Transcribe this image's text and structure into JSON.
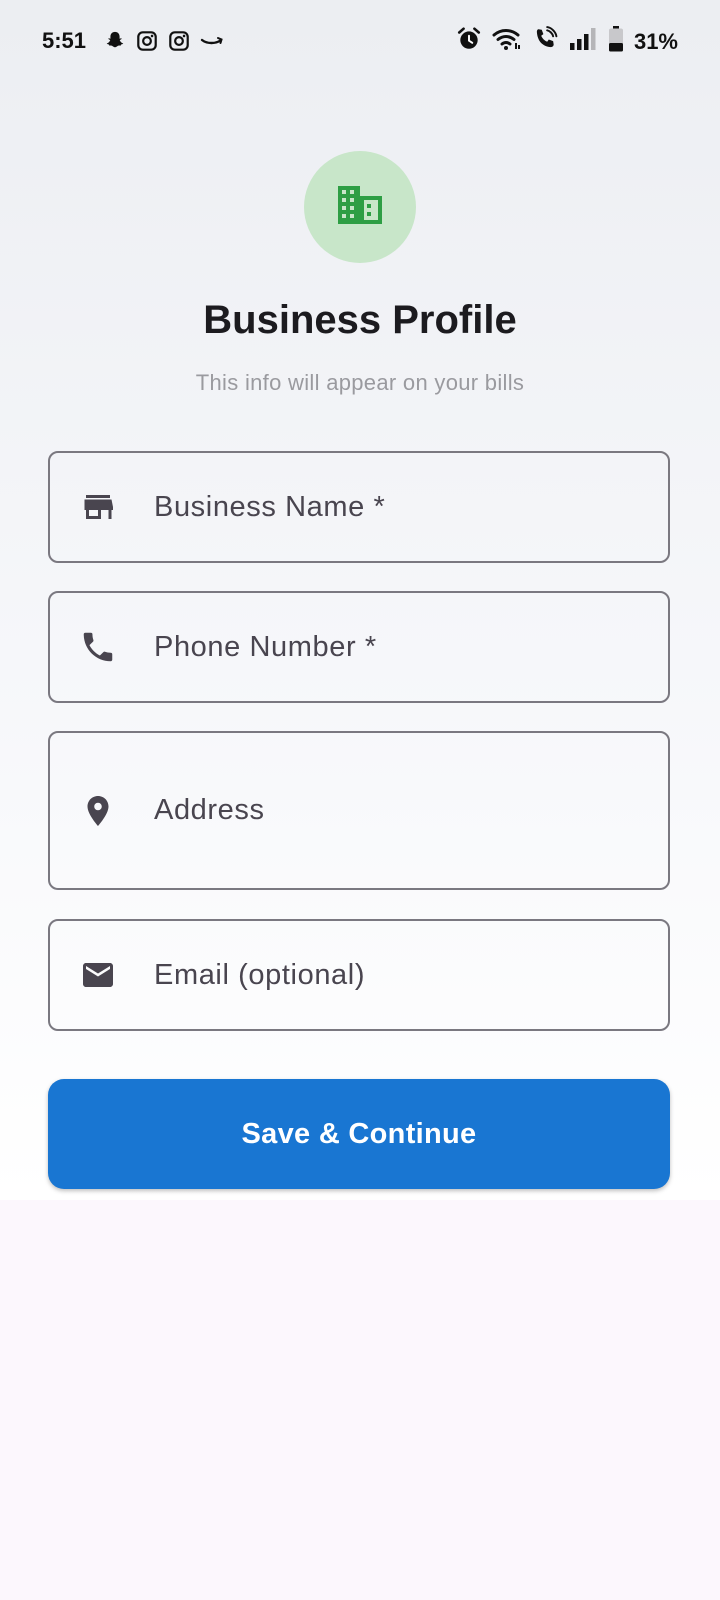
{
  "status_bar": {
    "time": "5:51",
    "battery": "31%",
    "left_icons": [
      "snapchat-icon",
      "instagram-icon",
      "instagram-icon",
      "amazon-icon"
    ],
    "right_icons": [
      "alarm-icon",
      "wifi-icon",
      "wifi-calling-icon",
      "signal-icon",
      "battery-icon"
    ]
  },
  "header": {
    "logo_icon": "building-icon",
    "logo_color": "#2e9e44",
    "logo_bg": "#c8e6c9",
    "title": "Business Profile",
    "subtitle": "This info will appear on your bills"
  },
  "form": {
    "fields": [
      {
        "icon": "store-icon",
        "placeholder": "Business Name *",
        "value": ""
      },
      {
        "icon": "phone-icon",
        "placeholder": "Phone Number *",
        "value": ""
      },
      {
        "icon": "location-pin-icon",
        "placeholder": "Address",
        "value": ""
      },
      {
        "icon": "mail-icon",
        "placeholder": "Email (optional)",
        "value": ""
      }
    ],
    "submit_label": "Save & Continue",
    "accent_color": "#1976d2"
  }
}
